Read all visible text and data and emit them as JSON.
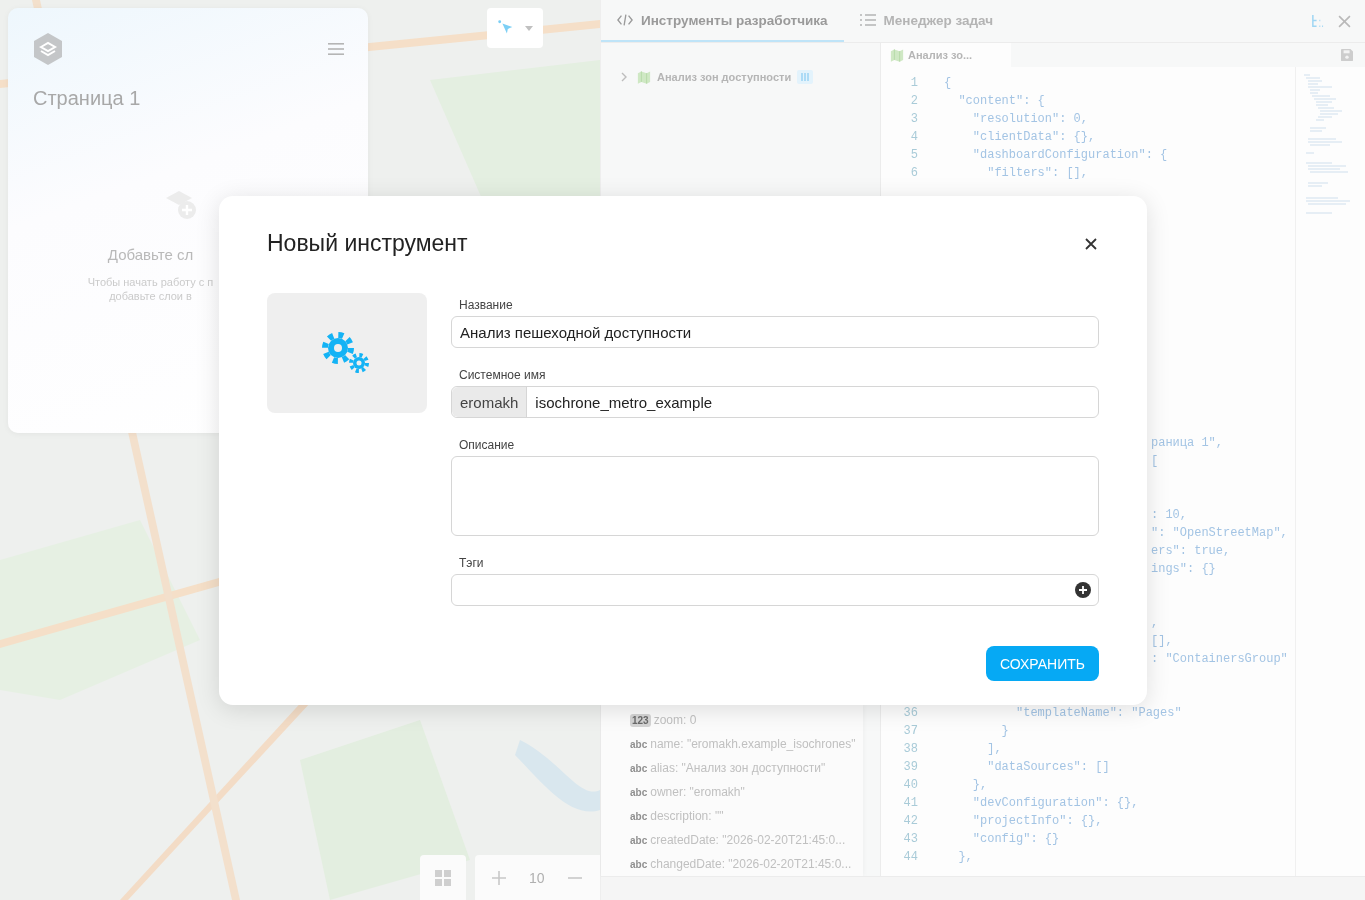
{
  "page_panel": {
    "title": "Страница 1",
    "empty_title": "Добавьте сл",
    "empty_text_lines": [
      "Чтобы начать работу с п",
      "добавьте слои в"
    ]
  },
  "zoom_controls": {
    "value": "10"
  },
  "devtools": {
    "tabs": [
      {
        "label": "Инструменты разработчика",
        "selected": true
      },
      {
        "label": "Менеджер задач",
        "selected": false
      }
    ],
    "tree": [
      {
        "label": "Анализ зон доступности",
        "expanded": false
      }
    ],
    "properties": [
      {
        "kind": "number",
        "type_label": "123",
        "text": "zoom: 0"
      },
      {
        "kind": "string",
        "type_label": "abc",
        "text": "name: \"eromakh.example_isochrones\""
      },
      {
        "kind": "string",
        "type_label": "abc",
        "text": "alias: \"Анализ зон доступности\""
      },
      {
        "kind": "string",
        "type_label": "abc",
        "text": "owner: \"eromakh\""
      },
      {
        "kind": "string",
        "type_label": "abc",
        "text": "description: \"\""
      },
      {
        "kind": "string",
        "type_label": "abc",
        "text": "createdDate: \"2026-02-20T21:45:0..."
      },
      {
        "kind": "string",
        "type_label": "abc",
        "text": "changedDate: \"2026-02-20T21:45:0..."
      }
    ],
    "editor": {
      "tab": "Анализ зо...",
      "top_lines": [
        {
          "number": "1",
          "text": "{"
        },
        {
          "number": "2",
          "text": "  \"content\": {"
        },
        {
          "number": "3",
          "text": "    \"resolution\": 0,"
        },
        {
          "number": "4",
          "text": "    \"clientData\": {},"
        },
        {
          "number": "5",
          "text": "    \"dashboardConfiguration\": {"
        },
        {
          "number": "6",
          "text": "      \"filters\": [],"
        }
      ],
      "fragment_groups": [
        [
          "раница 1\",",
          "["
        ],
        [
          ": 10,",
          "\": \"OpenStreetMap\",",
          "ers\": true,",
          "ings\": {}"
        ],
        [
          ",",
          "[],",
          ": \"ContainersGroup\""
        ]
      ],
      "bottom_lines": [
        {
          "number": "36",
          "text": "          \"templateName\": \"Pages\""
        },
        {
          "number": "37",
          "text": "        }"
        },
        {
          "number": "38",
          "text": "      ],"
        },
        {
          "number": "39",
          "text": "      \"dataSources\": []"
        },
        {
          "number": "40",
          "text": "    },"
        },
        {
          "number": "41",
          "text": "    \"devConfiguration\": {},"
        },
        {
          "number": "42",
          "text": "    \"projectInfo\": {},"
        },
        {
          "number": "43",
          "text": "    \"config\": {}"
        },
        {
          "number": "44",
          "text": "  },"
        }
      ]
    }
  },
  "dialog": {
    "title": "Новый инструмент",
    "fields": [
      {
        "kind": "text",
        "label": "Название",
        "value": "Анализ пешеходной доступности"
      },
      {
        "kind": "prefixed",
        "label": "Системное имя",
        "prefix": "eromakh",
        "value": "isochrone_metro_example"
      },
      {
        "kind": "textarea",
        "label": "Описание"
      },
      {
        "kind": "tags",
        "label": "Тэги"
      }
    ],
    "save_button": "СОХРАНИТЬ"
  }
}
